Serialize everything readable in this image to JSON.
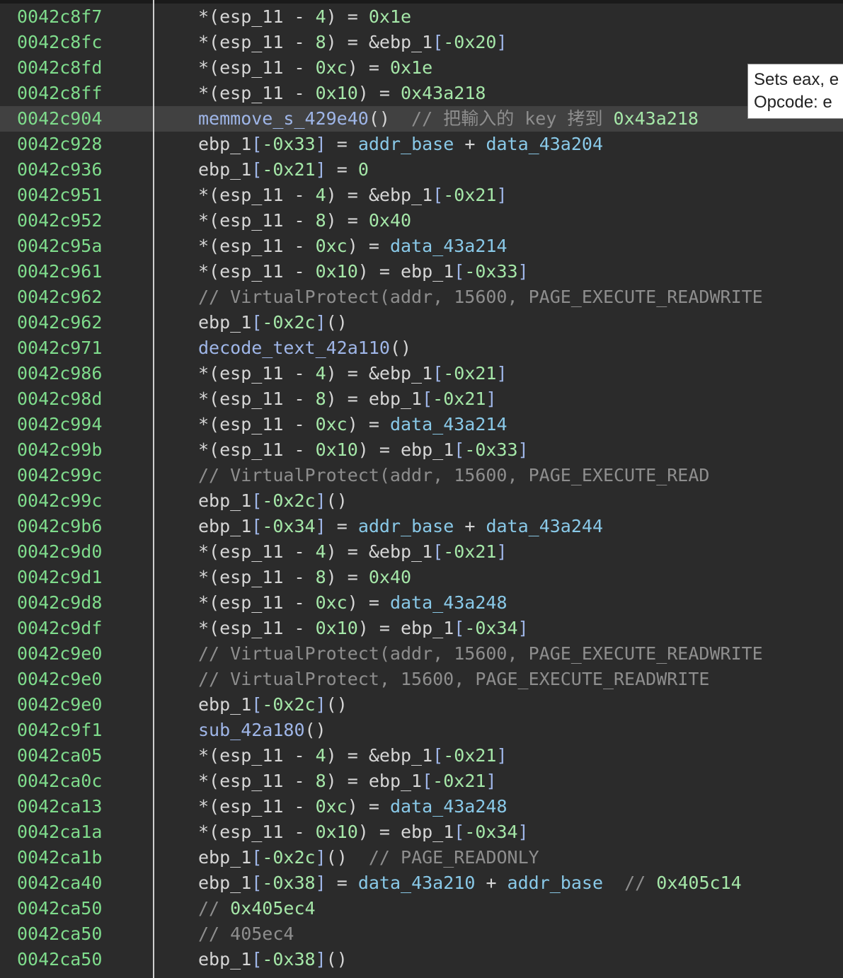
{
  "colors": {
    "background": "#2b2b2b",
    "highlight_row": "#414141",
    "address": "#7fdc8c",
    "number": "#a5e7a8",
    "data_symbol": "#89c9e8",
    "function": "#9fb6e8",
    "comment": "#8e8e8e",
    "text": "#d6d6d6"
  },
  "tooltip": {
    "line1": "Sets eax, e",
    "line2": "Opcode: e"
  },
  "lines": [
    {
      "addr": "0042c8f7",
      "tokens": [
        [
          "*(esp_11 - ",
          "plain"
        ],
        [
          "4",
          "num"
        ],
        [
          ") = ",
          "plain"
        ],
        [
          "0x1e",
          "num"
        ]
      ]
    },
    {
      "addr": "0042c8fc",
      "tokens": [
        [
          "*(esp_11 - ",
          "plain"
        ],
        [
          "8",
          "num"
        ],
        [
          ") = &ebp_1",
          "plain"
        ],
        [
          "[",
          "brk"
        ],
        [
          "-0x20",
          "num"
        ],
        [
          "]",
          "brk"
        ]
      ]
    },
    {
      "addr": "0042c8fd",
      "tokens": [
        [
          "*(esp_11 - ",
          "plain"
        ],
        [
          "0xc",
          "num"
        ],
        [
          ") = ",
          "plain"
        ],
        [
          "0x1e",
          "num"
        ]
      ]
    },
    {
      "addr": "0042c8ff",
      "tokens": [
        [
          "*(esp_11 - ",
          "plain"
        ],
        [
          "0x10",
          "num"
        ],
        [
          ") = ",
          "plain"
        ],
        [
          "0x43a218",
          "num"
        ]
      ]
    },
    {
      "addr": "0042c904",
      "highlight": true,
      "tokens": [
        [
          "memmove_s_429e40",
          "func"
        ],
        [
          "()  ",
          "plain"
        ],
        [
          "// 把輸入的 key 拷到 ",
          "cmt"
        ],
        [
          "0x43a218",
          "cnum"
        ]
      ]
    },
    {
      "addr": "0042c928",
      "tokens": [
        [
          "ebp_1",
          "plain"
        ],
        [
          "[",
          "brk"
        ],
        [
          "-0x33",
          "num"
        ],
        [
          "]",
          "brk"
        ],
        [
          " = ",
          "plain"
        ],
        [
          "addr_base",
          "data"
        ],
        [
          " + ",
          "plain"
        ],
        [
          "data_43a204",
          "data"
        ]
      ]
    },
    {
      "addr": "0042c936",
      "tokens": [
        [
          "ebp_1",
          "plain"
        ],
        [
          "[",
          "brk"
        ],
        [
          "-0x21",
          "num"
        ],
        [
          "]",
          "brk"
        ],
        [
          " = ",
          "plain"
        ],
        [
          "0",
          "num"
        ]
      ]
    },
    {
      "addr": "0042c951",
      "tokens": [
        [
          "*(esp_11 - ",
          "plain"
        ],
        [
          "4",
          "num"
        ],
        [
          ") = &ebp_1",
          "plain"
        ],
        [
          "[",
          "brk"
        ],
        [
          "-0x21",
          "num"
        ],
        [
          "]",
          "brk"
        ]
      ]
    },
    {
      "addr": "0042c952",
      "tokens": [
        [
          "*(esp_11 - ",
          "plain"
        ],
        [
          "8",
          "num"
        ],
        [
          ") = ",
          "plain"
        ],
        [
          "0x40",
          "num"
        ]
      ]
    },
    {
      "addr": "0042c95a",
      "tokens": [
        [
          "*(esp_11 - ",
          "plain"
        ],
        [
          "0xc",
          "num"
        ],
        [
          ") = ",
          "plain"
        ],
        [
          "data_43a214",
          "data"
        ]
      ]
    },
    {
      "addr": "0042c961",
      "tokens": [
        [
          "*(esp_11 - ",
          "plain"
        ],
        [
          "0x10",
          "num"
        ],
        [
          ") = ebp_1",
          "plain"
        ],
        [
          "[",
          "brk"
        ],
        [
          "-0x33",
          "num"
        ],
        [
          "]",
          "brk"
        ]
      ]
    },
    {
      "addr": "0042c962",
      "tokens": [
        [
          "// VirtualProtect(addr, 15600, PAGE_EXECUTE_READWRITE",
          "cmt"
        ]
      ]
    },
    {
      "addr": "0042c962",
      "tokens": [
        [
          "ebp_1",
          "plain"
        ],
        [
          "[",
          "brk"
        ],
        [
          "-0x2c",
          "num"
        ],
        [
          "]",
          "brk"
        ],
        [
          "()",
          "plain"
        ]
      ]
    },
    {
      "addr": "0042c971",
      "tokens": [
        [
          "decode_text_42a110",
          "func"
        ],
        [
          "()",
          "plain"
        ]
      ]
    },
    {
      "addr": "0042c986",
      "tokens": [
        [
          "*(esp_11 - ",
          "plain"
        ],
        [
          "4",
          "num"
        ],
        [
          ") = &ebp_1",
          "plain"
        ],
        [
          "[",
          "brk"
        ],
        [
          "-0x21",
          "num"
        ],
        [
          "]",
          "brk"
        ]
      ]
    },
    {
      "addr": "0042c98d",
      "tokens": [
        [
          "*(esp_11 - ",
          "plain"
        ],
        [
          "8",
          "num"
        ],
        [
          ") = ebp_1",
          "plain"
        ],
        [
          "[",
          "brk"
        ],
        [
          "-0x21",
          "num"
        ],
        [
          "]",
          "brk"
        ]
      ]
    },
    {
      "addr": "0042c994",
      "tokens": [
        [
          "*(esp_11 - ",
          "plain"
        ],
        [
          "0xc",
          "num"
        ],
        [
          ") = ",
          "plain"
        ],
        [
          "data_43a214",
          "data"
        ]
      ]
    },
    {
      "addr": "0042c99b",
      "tokens": [
        [
          "*(esp_11 - ",
          "plain"
        ],
        [
          "0x10",
          "num"
        ],
        [
          ") = ebp_1",
          "plain"
        ],
        [
          "[",
          "brk"
        ],
        [
          "-0x33",
          "num"
        ],
        [
          "]",
          "brk"
        ]
      ]
    },
    {
      "addr": "0042c99c",
      "tokens": [
        [
          "// VirtualProtect(addr, 15600, PAGE_EXECUTE_READ",
          "cmt"
        ]
      ]
    },
    {
      "addr": "0042c99c",
      "tokens": [
        [
          "ebp_1",
          "plain"
        ],
        [
          "[",
          "brk"
        ],
        [
          "-0x2c",
          "num"
        ],
        [
          "]",
          "brk"
        ],
        [
          "()",
          "plain"
        ]
      ]
    },
    {
      "addr": "0042c9b6",
      "tokens": [
        [
          "ebp_1",
          "plain"
        ],
        [
          "[",
          "brk"
        ],
        [
          "-0x34",
          "num"
        ],
        [
          "]",
          "brk"
        ],
        [
          " = ",
          "plain"
        ],
        [
          "addr_base",
          "data"
        ],
        [
          " + ",
          "plain"
        ],
        [
          "data_43a244",
          "data"
        ]
      ]
    },
    {
      "addr": "0042c9d0",
      "tokens": [
        [
          "*(esp_11 - ",
          "plain"
        ],
        [
          "4",
          "num"
        ],
        [
          ") = &ebp_1",
          "plain"
        ],
        [
          "[",
          "brk"
        ],
        [
          "-0x21",
          "num"
        ],
        [
          "]",
          "brk"
        ]
      ]
    },
    {
      "addr": "0042c9d1",
      "tokens": [
        [
          "*(esp_11 - ",
          "plain"
        ],
        [
          "8",
          "num"
        ],
        [
          ") = ",
          "plain"
        ],
        [
          "0x40",
          "num"
        ]
      ]
    },
    {
      "addr": "0042c9d8",
      "tokens": [
        [
          "*(esp_11 - ",
          "plain"
        ],
        [
          "0xc",
          "num"
        ],
        [
          ") = ",
          "plain"
        ],
        [
          "data_43a248",
          "data"
        ]
      ]
    },
    {
      "addr": "0042c9df",
      "tokens": [
        [
          "*(esp_11 - ",
          "plain"
        ],
        [
          "0x10",
          "num"
        ],
        [
          ") = ebp_1",
          "plain"
        ],
        [
          "[",
          "brk"
        ],
        [
          "-0x34",
          "num"
        ],
        [
          "]",
          "brk"
        ]
      ]
    },
    {
      "addr": "0042c9e0",
      "tokens": [
        [
          "// VirtualProtect(addr, 15600, PAGE_EXECUTE_READWRITE",
          "cmt"
        ]
      ]
    },
    {
      "addr": "0042c9e0",
      "tokens": [
        [
          "// VirtualProtect, 15600, PAGE_EXECUTE_READWRITE",
          "cmt"
        ]
      ]
    },
    {
      "addr": "0042c9e0",
      "tokens": [
        [
          "ebp_1",
          "plain"
        ],
        [
          "[",
          "brk"
        ],
        [
          "-0x2c",
          "num"
        ],
        [
          "]",
          "brk"
        ],
        [
          "()",
          "plain"
        ]
      ]
    },
    {
      "addr": "0042c9f1",
      "tokens": [
        [
          "sub_42a180",
          "func"
        ],
        [
          "()",
          "plain"
        ]
      ]
    },
    {
      "addr": "0042ca05",
      "tokens": [
        [
          "*(esp_11 - ",
          "plain"
        ],
        [
          "4",
          "num"
        ],
        [
          ") = &ebp_1",
          "plain"
        ],
        [
          "[",
          "brk"
        ],
        [
          "-0x21",
          "num"
        ],
        [
          "]",
          "brk"
        ]
      ]
    },
    {
      "addr": "0042ca0c",
      "tokens": [
        [
          "*(esp_11 - ",
          "plain"
        ],
        [
          "8",
          "num"
        ],
        [
          ") = ebp_1",
          "plain"
        ],
        [
          "[",
          "brk"
        ],
        [
          "-0x21",
          "num"
        ],
        [
          "]",
          "brk"
        ]
      ]
    },
    {
      "addr": "0042ca13",
      "tokens": [
        [
          "*(esp_11 - ",
          "plain"
        ],
        [
          "0xc",
          "num"
        ],
        [
          ") = ",
          "plain"
        ],
        [
          "data_43a248",
          "data"
        ]
      ]
    },
    {
      "addr": "0042ca1a",
      "tokens": [
        [
          "*(esp_11 - ",
          "plain"
        ],
        [
          "0x10",
          "num"
        ],
        [
          ") = ebp_1",
          "plain"
        ],
        [
          "[",
          "brk"
        ],
        [
          "-0x34",
          "num"
        ],
        [
          "]",
          "brk"
        ]
      ]
    },
    {
      "addr": "0042ca1b",
      "tokens": [
        [
          "ebp_1",
          "plain"
        ],
        [
          "[",
          "brk"
        ],
        [
          "-0x2c",
          "num"
        ],
        [
          "]",
          "brk"
        ],
        [
          "()  ",
          "plain"
        ],
        [
          "// PAGE_READONLY",
          "cmt"
        ]
      ]
    },
    {
      "addr": "0042ca40",
      "tokens": [
        [
          "ebp_1",
          "plain"
        ],
        [
          "[",
          "brk"
        ],
        [
          "-0x38",
          "num"
        ],
        [
          "]",
          "brk"
        ],
        [
          " = ",
          "plain"
        ],
        [
          "data_43a210",
          "data"
        ],
        [
          " + ",
          "plain"
        ],
        [
          "addr_base",
          "data"
        ],
        [
          "  // ",
          "cmt"
        ],
        [
          "0x405c14",
          "cnum"
        ]
      ]
    },
    {
      "addr": "0042ca50",
      "tokens": [
        [
          "// ",
          "cmt"
        ],
        [
          "0x405ec4",
          "cnum"
        ]
      ]
    },
    {
      "addr": "0042ca50",
      "tokens": [
        [
          "// 405ec4",
          "cmt"
        ]
      ]
    },
    {
      "addr": "0042ca50",
      "tokens": [
        [
          "ebp_1",
          "plain"
        ],
        [
          "[",
          "brk"
        ],
        [
          "-0x38",
          "num"
        ],
        [
          "]",
          "brk"
        ],
        [
          "()",
          "plain"
        ]
      ]
    }
  ]
}
